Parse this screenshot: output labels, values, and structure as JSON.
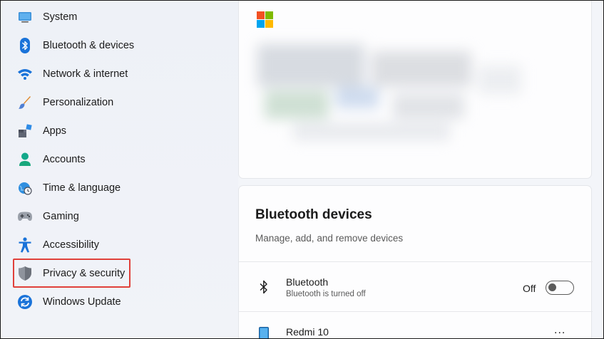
{
  "sidebar": {
    "items": [
      {
        "label": "System",
        "icon": "monitor-icon"
      },
      {
        "label": "Bluetooth & devices",
        "icon": "bluetooth-icon"
      },
      {
        "label": "Network & internet",
        "icon": "wifi-icon"
      },
      {
        "label": "Personalization",
        "icon": "brush-icon"
      },
      {
        "label": "Apps",
        "icon": "apps-icon"
      },
      {
        "label": "Accounts",
        "icon": "person-icon"
      },
      {
        "label": "Time & language",
        "icon": "globe-clock-icon"
      },
      {
        "label": "Gaming",
        "icon": "gamepad-icon"
      },
      {
        "label": "Accessibility",
        "icon": "accessibility-icon"
      },
      {
        "label": "Privacy & security",
        "icon": "shield-icon"
      },
      {
        "label": "Windows Update",
        "icon": "update-icon"
      }
    ],
    "highlighted_item": "Privacy & security"
  },
  "main": {
    "bluetooth_card": {
      "title": "Bluetooth devices",
      "subtitle": "Manage, add, and remove devices",
      "bluetooth_row": {
        "title": "Bluetooth",
        "subtitle": "Bluetooth is turned off",
        "toggle_label": "Off",
        "toggle_on": false
      },
      "device_row": {
        "title": "Redmi 10",
        "more_label": "..."
      }
    }
  },
  "colors": {
    "highlight_border": "#e0403a",
    "accent_blue": "#0067c0",
    "ms_red": "#f25022",
    "ms_green": "#7fba00",
    "ms_blue": "#00a4ef",
    "ms_yellow": "#ffb900"
  }
}
